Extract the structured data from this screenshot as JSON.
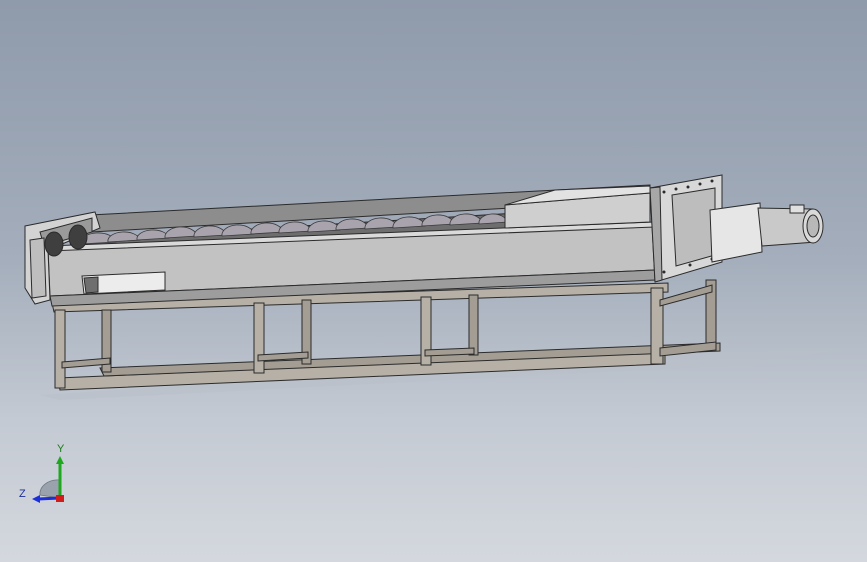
{
  "viewport": {
    "background_top": "#8f9aab",
    "background_bottom": "#d4d8de"
  },
  "model": {
    "icons": [
      "screw-conveyor-model"
    ],
    "colors": {
      "frame": "#b6b0a6",
      "trough": "#bdbdbd",
      "flight": "#a8a3ad",
      "motor": "#d6d6d6",
      "edge": "#2b2b2b"
    }
  },
  "triad": {
    "y_label": "Y",
    "z_label": "Z",
    "colors": {
      "y": "#1fa81f",
      "z": "#1c2fd8",
      "x": "#d21b1b"
    }
  }
}
